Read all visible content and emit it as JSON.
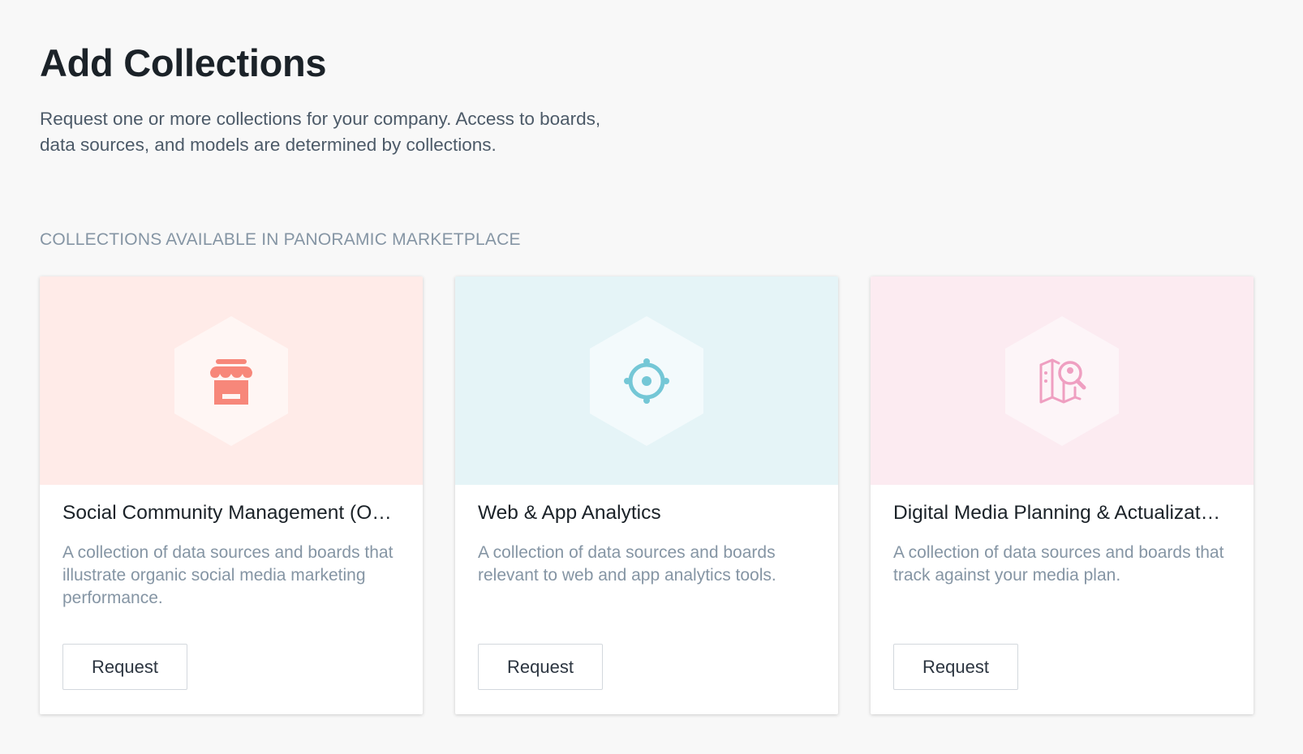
{
  "header": {
    "title": "Add Collections",
    "description_lines": [
      "Request one or more collections for your company. Access to boards,",
      "data sources, and models are determined by collections."
    ]
  },
  "marketplace": {
    "section_title": "COLLECTIONS AVAILABLE IN PANORAMIC MARKETPLACE",
    "cards": [
      {
        "title": "Social Community Management (O…",
        "description": "A collection of data sources and boards that illustrate organic social media marketing performance.",
        "button_label": "Request",
        "icon": "storefront-icon",
        "banner_color": "#ffebe8",
        "hex_color": "#fff6f4",
        "accent_color": "#f7877a"
      },
      {
        "title": "Web & App Analytics",
        "description": "A collection of data sources and boards relevant to web and app analytics tools.",
        "button_label": "Request",
        "icon": "crosshair-target-icon",
        "banner_color": "#e5f4f7",
        "hex_color": "#f3fafc",
        "accent_color": "#74c7d6"
      },
      {
        "title": "Digital Media Planning & Actualizat…",
        "description": "A collection of data sources and boards that track against your media plan.",
        "button_label": "Request",
        "icon": "map-search-icon",
        "banner_color": "#fcebf1",
        "hex_color": "#fdf5f8",
        "accent_color": "#ef9fc1"
      }
    ]
  }
}
